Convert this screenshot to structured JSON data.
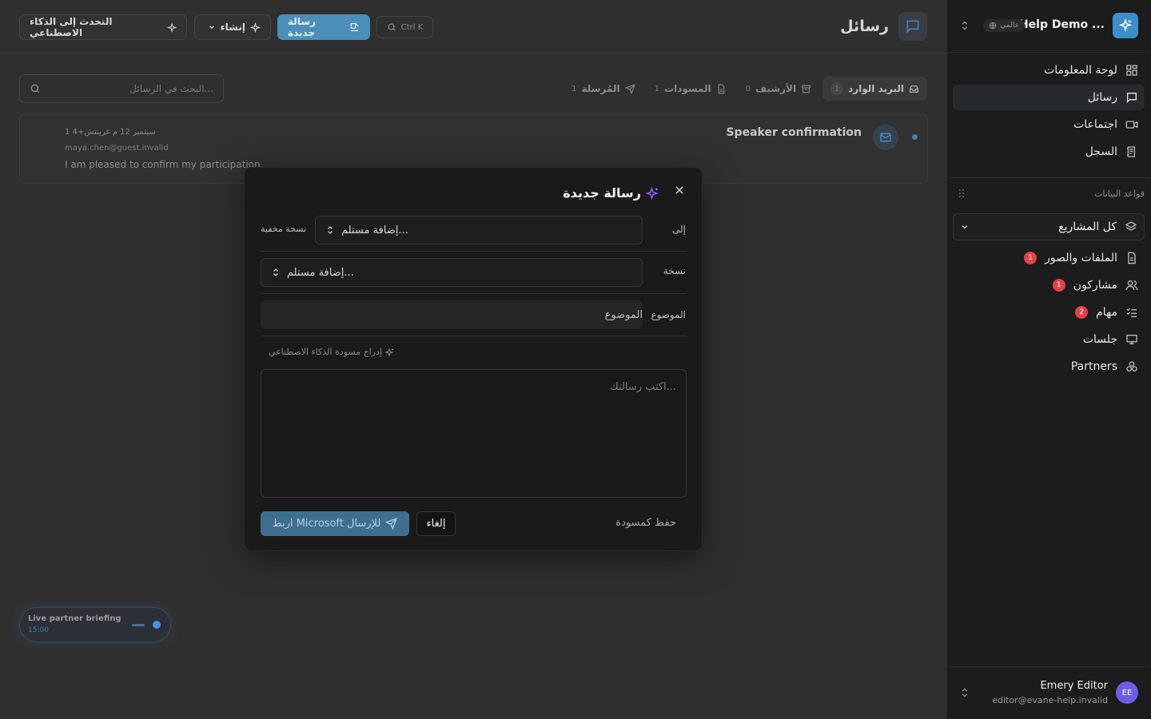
{
  "sidebar": {
    "workspace": {
      "name": "Help Demo ...",
      "badge": "عالمي"
    },
    "nav": [
      {
        "label": "لوحة المعلومات",
        "icon": "dashboard-icon"
      },
      {
        "label": "رسائل",
        "icon": "chat-icon"
      },
      {
        "label": "اجتماعات",
        "icon": "video-icon"
      },
      {
        "label": "السجل",
        "icon": "log-icon"
      }
    ],
    "databases_label": "قواعد البيانات",
    "project_select": "كل المشاريع",
    "databases": [
      {
        "label": "الملفات والصور",
        "count": "1",
        "icon": "file-icon"
      },
      {
        "label": "مشاركون",
        "count": "1",
        "icon": "users-icon"
      },
      {
        "label": "مهام",
        "count": "2",
        "icon": "tasks-icon"
      },
      {
        "label": "جلسات",
        "count": "",
        "icon": "presentation-icon"
      },
      {
        "label": "Partners",
        "count": "",
        "icon": "partners-icon"
      }
    ],
    "user": {
      "initials": "EE",
      "name": "Emery Editor",
      "email": "editor@evane-help.invalid"
    }
  },
  "header": {
    "title": "رسائل",
    "new_message": "رسالة جديدة",
    "create": "إنشاء",
    "ai_chat": "التحدث إلى الذكاء الاصطناعي",
    "shortcut": "Ctrl K"
  },
  "tabs": [
    {
      "label": "البريد الوارد",
      "count": "1"
    },
    {
      "label": "الأرشيف",
      "count": "0"
    },
    {
      "label": "المسودات",
      "count": "1"
    },
    {
      "label": "المُرسلة",
      "count": "1"
    }
  ],
  "search": {
    "placeholder": "البحث في الرسائل..."
  },
  "message": {
    "subject": "Speaker confirmation",
    "date": "1 سبتمبر 12 م غرينتش+4",
    "from": "maya.chen@guest.invalid",
    "preview": "I am pleased to confirm my participation."
  },
  "live": {
    "title": "Live partner briefing",
    "time": "15:00"
  },
  "modal": {
    "title": "رسالة جديدة",
    "to_label": "إلى",
    "bcc_label": "نسخة مخفية",
    "cc_label": "نسخة",
    "recipient_placeholder": "إضافة مستلم...",
    "subject_label": "الموضوع",
    "subject_placeholder": "الموضوع",
    "ai_draft": "إدراج مسودة الذكاء الاصطناعي",
    "body_placeholder": "اكتب رسالتك...",
    "send": "اربط Microsoft للإرسال",
    "cancel": "إلغاء",
    "save_draft": "حفظ كمسودة"
  },
  "colors": {
    "accent": "#4b8fb8",
    "badge": "#e5404a",
    "avatar": "#6a5ee8",
    "ai": "#8b5cf6"
  }
}
